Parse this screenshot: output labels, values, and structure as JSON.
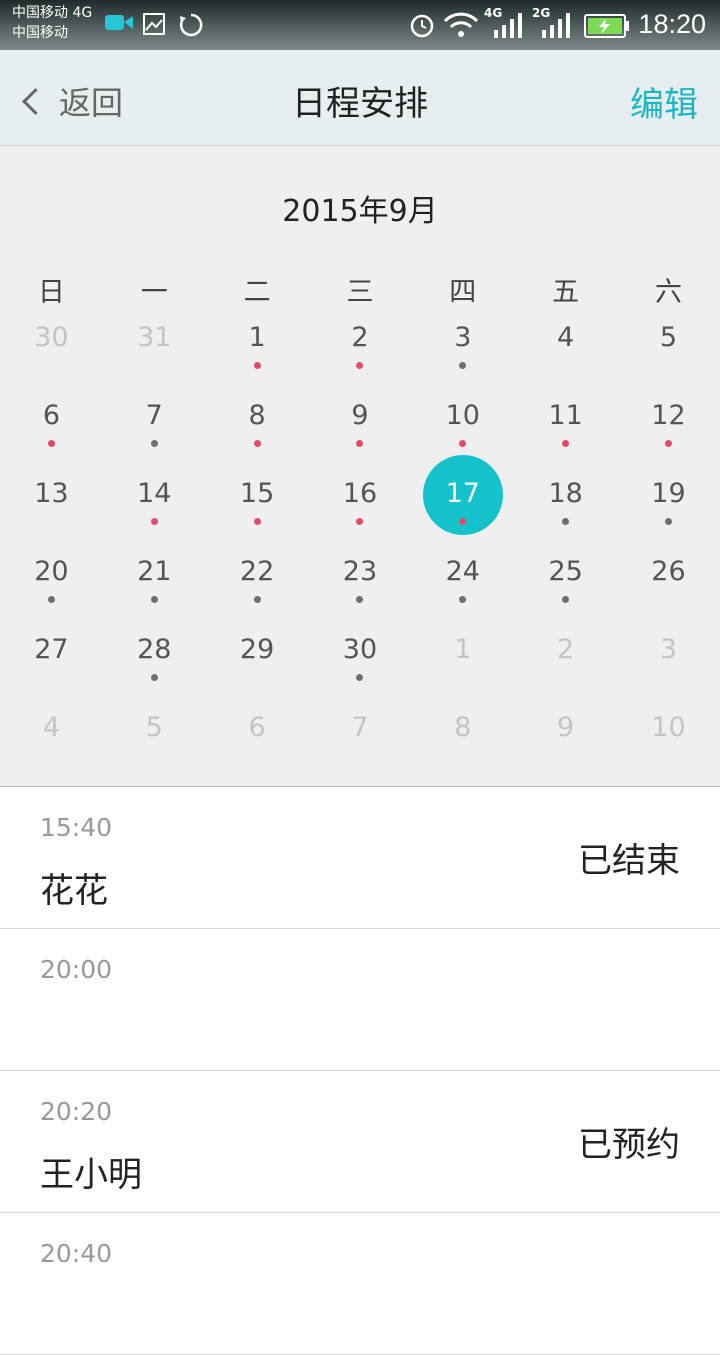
{
  "status_bar": {
    "carrier1": "中国移动 4G",
    "carrier2": "中国移动",
    "net1": "4G",
    "net2": "2G",
    "time": "18:20"
  },
  "header": {
    "back_label": "返回",
    "title": "日程安排",
    "edit_label": "编辑"
  },
  "calendar": {
    "month_label": "2015年9月",
    "weekdays": [
      "日",
      "一",
      "二",
      "三",
      "四",
      "五",
      "六"
    ],
    "weeks": [
      [
        {
          "d": "30",
          "o": true
        },
        {
          "d": "31",
          "o": true
        },
        {
          "d": "1",
          "dot": "red"
        },
        {
          "d": "2",
          "dot": "red"
        },
        {
          "d": "3",
          "dot": "gray"
        },
        {
          "d": "4"
        },
        {
          "d": "5"
        }
      ],
      [
        {
          "d": "6",
          "dot": "red"
        },
        {
          "d": "7",
          "dot": "gray"
        },
        {
          "d": "8",
          "dot": "red"
        },
        {
          "d": "9",
          "dot": "red"
        },
        {
          "d": "10",
          "dot": "red"
        },
        {
          "d": "11",
          "dot": "red"
        },
        {
          "d": "12",
          "dot": "red"
        }
      ],
      [
        {
          "d": "13"
        },
        {
          "d": "14",
          "dot": "red"
        },
        {
          "d": "15",
          "dot": "red"
        },
        {
          "d": "16",
          "dot": "red"
        },
        {
          "d": "17",
          "dot": "red",
          "sel": true
        },
        {
          "d": "18",
          "dot": "gray"
        },
        {
          "d": "19",
          "dot": "gray"
        }
      ],
      [
        {
          "d": "20",
          "dot": "gray"
        },
        {
          "d": "21",
          "dot": "gray"
        },
        {
          "d": "22",
          "dot": "gray"
        },
        {
          "d": "23",
          "dot": "gray"
        },
        {
          "d": "24",
          "dot": "gray"
        },
        {
          "d": "25",
          "dot": "gray"
        },
        {
          "d": "26"
        }
      ],
      [
        {
          "d": "27"
        },
        {
          "d": "28",
          "dot": "gray"
        },
        {
          "d": "29"
        },
        {
          "d": "30",
          "dot": "gray"
        },
        {
          "d": "1",
          "o": true
        },
        {
          "d": "2",
          "o": true
        },
        {
          "d": "3",
          "o": true
        }
      ],
      [
        {
          "d": "4",
          "o": true
        },
        {
          "d": "5",
          "o": true
        },
        {
          "d": "6",
          "o": true
        },
        {
          "d": "7",
          "o": true
        },
        {
          "d": "8",
          "o": true
        },
        {
          "d": "9",
          "o": true
        },
        {
          "d": "10",
          "o": true
        }
      ]
    ]
  },
  "schedule": [
    {
      "time": "15:40",
      "name": "花花",
      "status": "已结束"
    },
    {
      "time": "20:00",
      "name": "",
      "status": ""
    },
    {
      "time": "20:20",
      "name": "王小明",
      "status": "已预约"
    },
    {
      "time": "20:40",
      "name": "",
      "status": ""
    }
  ],
  "colors": {
    "accent": "#14c2cc",
    "dot_red": "#e44a6a",
    "dot_gray": "#6f6f6f"
  }
}
